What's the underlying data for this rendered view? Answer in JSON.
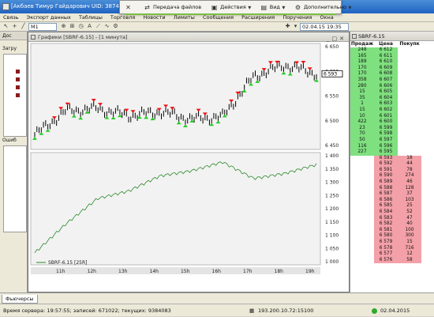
{
  "window": {
    "title": "[Акбаев Тимур Гайдарович UID: 3874] Ин"
  },
  "menu": [
    "Связь",
    "Экспорт данных",
    "Таблицы",
    "Торговля",
    "Новости",
    "Лимиты",
    "Сообщения",
    "Расширения",
    "Поручения",
    "Окна"
  ],
  "floating_toolbar": {
    "items": [
      {
        "label": "",
        "icon": "close-icon"
      },
      {
        "label": "Передача файлов",
        "icon": "transfer-icon"
      },
      {
        "label": "Действия",
        "icon": "actions-icon"
      },
      {
        "label": "Вид",
        "icon": "view-icon"
      },
      {
        "label": "Дополнительно",
        "icon": "gear-icon"
      }
    ]
  },
  "toolbar": {
    "timeframe": "M1",
    "date": "02.04.15 19:35"
  },
  "left_panel": {
    "header": "Дос",
    "label1": "Загру",
    "label2": "Ошиб"
  },
  "chart": {
    "window_title": "Графики [SBRF-6.15] - [1 минута]",
    "price_label": "6 593",
    "price_axis": [
      "6 650",
      "6 600",
      "6 550",
      "6 500",
      "6 450"
    ],
    "volume_axis": [
      "1 400",
      "1 350",
      "1 300",
      "1 250",
      "1 200",
      "1 150",
      "1 100",
      "1 050",
      "1 000"
    ],
    "time_axis": [
      "11h",
      "12h",
      "13h",
      "14h",
      "15h",
      "16h",
      "17h",
      "18h",
      "19h"
    ],
    "legend": "SBRF-6.15 [25R]",
    "colors": {
      "up": "#22cc22",
      "down": "#ee1111",
      "line": "#2a8a2a"
    }
  },
  "chart_data": [
    {
      "type": "line",
      "x": [
        "10h",
        "11h",
        "12h",
        "13h",
        "14h",
        "15h",
        "16h",
        "17h",
        "18h",
        "19h"
      ],
      "values": [
        6470,
        6520,
        6525,
        6510,
        6518,
        6503,
        6508,
        6592,
        6615,
        6597
      ],
      "ylim": [
        6440,
        6660
      ]
    },
    {
      "type": "line",
      "x": [
        "10h",
        "11h",
        "12h",
        "13h",
        "14h",
        "15h",
        "16h",
        "17h",
        "18h",
        "19h"
      ],
      "values": [
        1035,
        1150,
        1250,
        1280,
        1340,
        1360,
        1395,
        1330,
        1350,
        1385
      ],
      "ylim": [
        1000,
        1420
      ]
    }
  ],
  "order_book": {
    "title": "SBRF-6.15",
    "headers": [
      "Продаж",
      "Цена",
      "Покупк"
    ],
    "rows": [
      [
        "248",
        "6 612",
        ""
      ],
      [
        "165",
        "6 611",
        ""
      ],
      [
        "189",
        "6 610",
        ""
      ],
      [
        "170",
        "6 609",
        ""
      ],
      [
        "170",
        "6 608",
        ""
      ],
      [
        "358",
        "6 607",
        ""
      ],
      [
        "280",
        "6 606",
        ""
      ],
      [
        "15",
        "6 605",
        ""
      ],
      [
        "35",
        "6 604",
        ""
      ],
      [
        "1",
        "6 603",
        ""
      ],
      [
        "15",
        "6 602",
        ""
      ],
      [
        "10",
        "6 601",
        ""
      ],
      [
        "422",
        "6 600",
        ""
      ],
      [
        "23",
        "6 599",
        ""
      ],
      [
        "70",
        "6 598",
        ""
      ],
      [
        "50",
        "6 597",
        ""
      ],
      [
        "116",
        "6 596",
        ""
      ],
      [
        "227",
        "6 595",
        ""
      ],
      [
        "",
        "6 593",
        "18"
      ],
      [
        "",
        "6 592",
        "44"
      ],
      [
        "",
        "6 591",
        "78"
      ],
      [
        "",
        "6 590",
        "274"
      ],
      [
        "",
        "6 589",
        "46"
      ],
      [
        "",
        "6 588",
        "128"
      ],
      [
        "",
        "6 587",
        "37"
      ],
      [
        "",
        "6 586",
        "103"
      ],
      [
        "",
        "6 585",
        "25"
      ],
      [
        "",
        "6 584",
        "52"
      ],
      [
        "",
        "6 583",
        "47"
      ],
      [
        "",
        "6 582",
        "40"
      ],
      [
        "",
        "6 581",
        "100"
      ],
      [
        "",
        "6 580",
        "300"
      ],
      [
        "",
        "6 579",
        "15"
      ],
      [
        "",
        "6 578",
        "716"
      ],
      [
        "",
        "6 577",
        "12"
      ],
      [
        "",
        "6 576",
        "58"
      ]
    ],
    "sell_color": "#7fe07f",
    "buy_color": "#f4a0a8"
  },
  "bottom_tab": "Фьючерсы",
  "status": {
    "server_time": "Время сервера: 19:57:55; записей: 671022; текущих: 9384083",
    "server_ip": "193.200.10.72:15100",
    "date": "02.04.2015"
  }
}
